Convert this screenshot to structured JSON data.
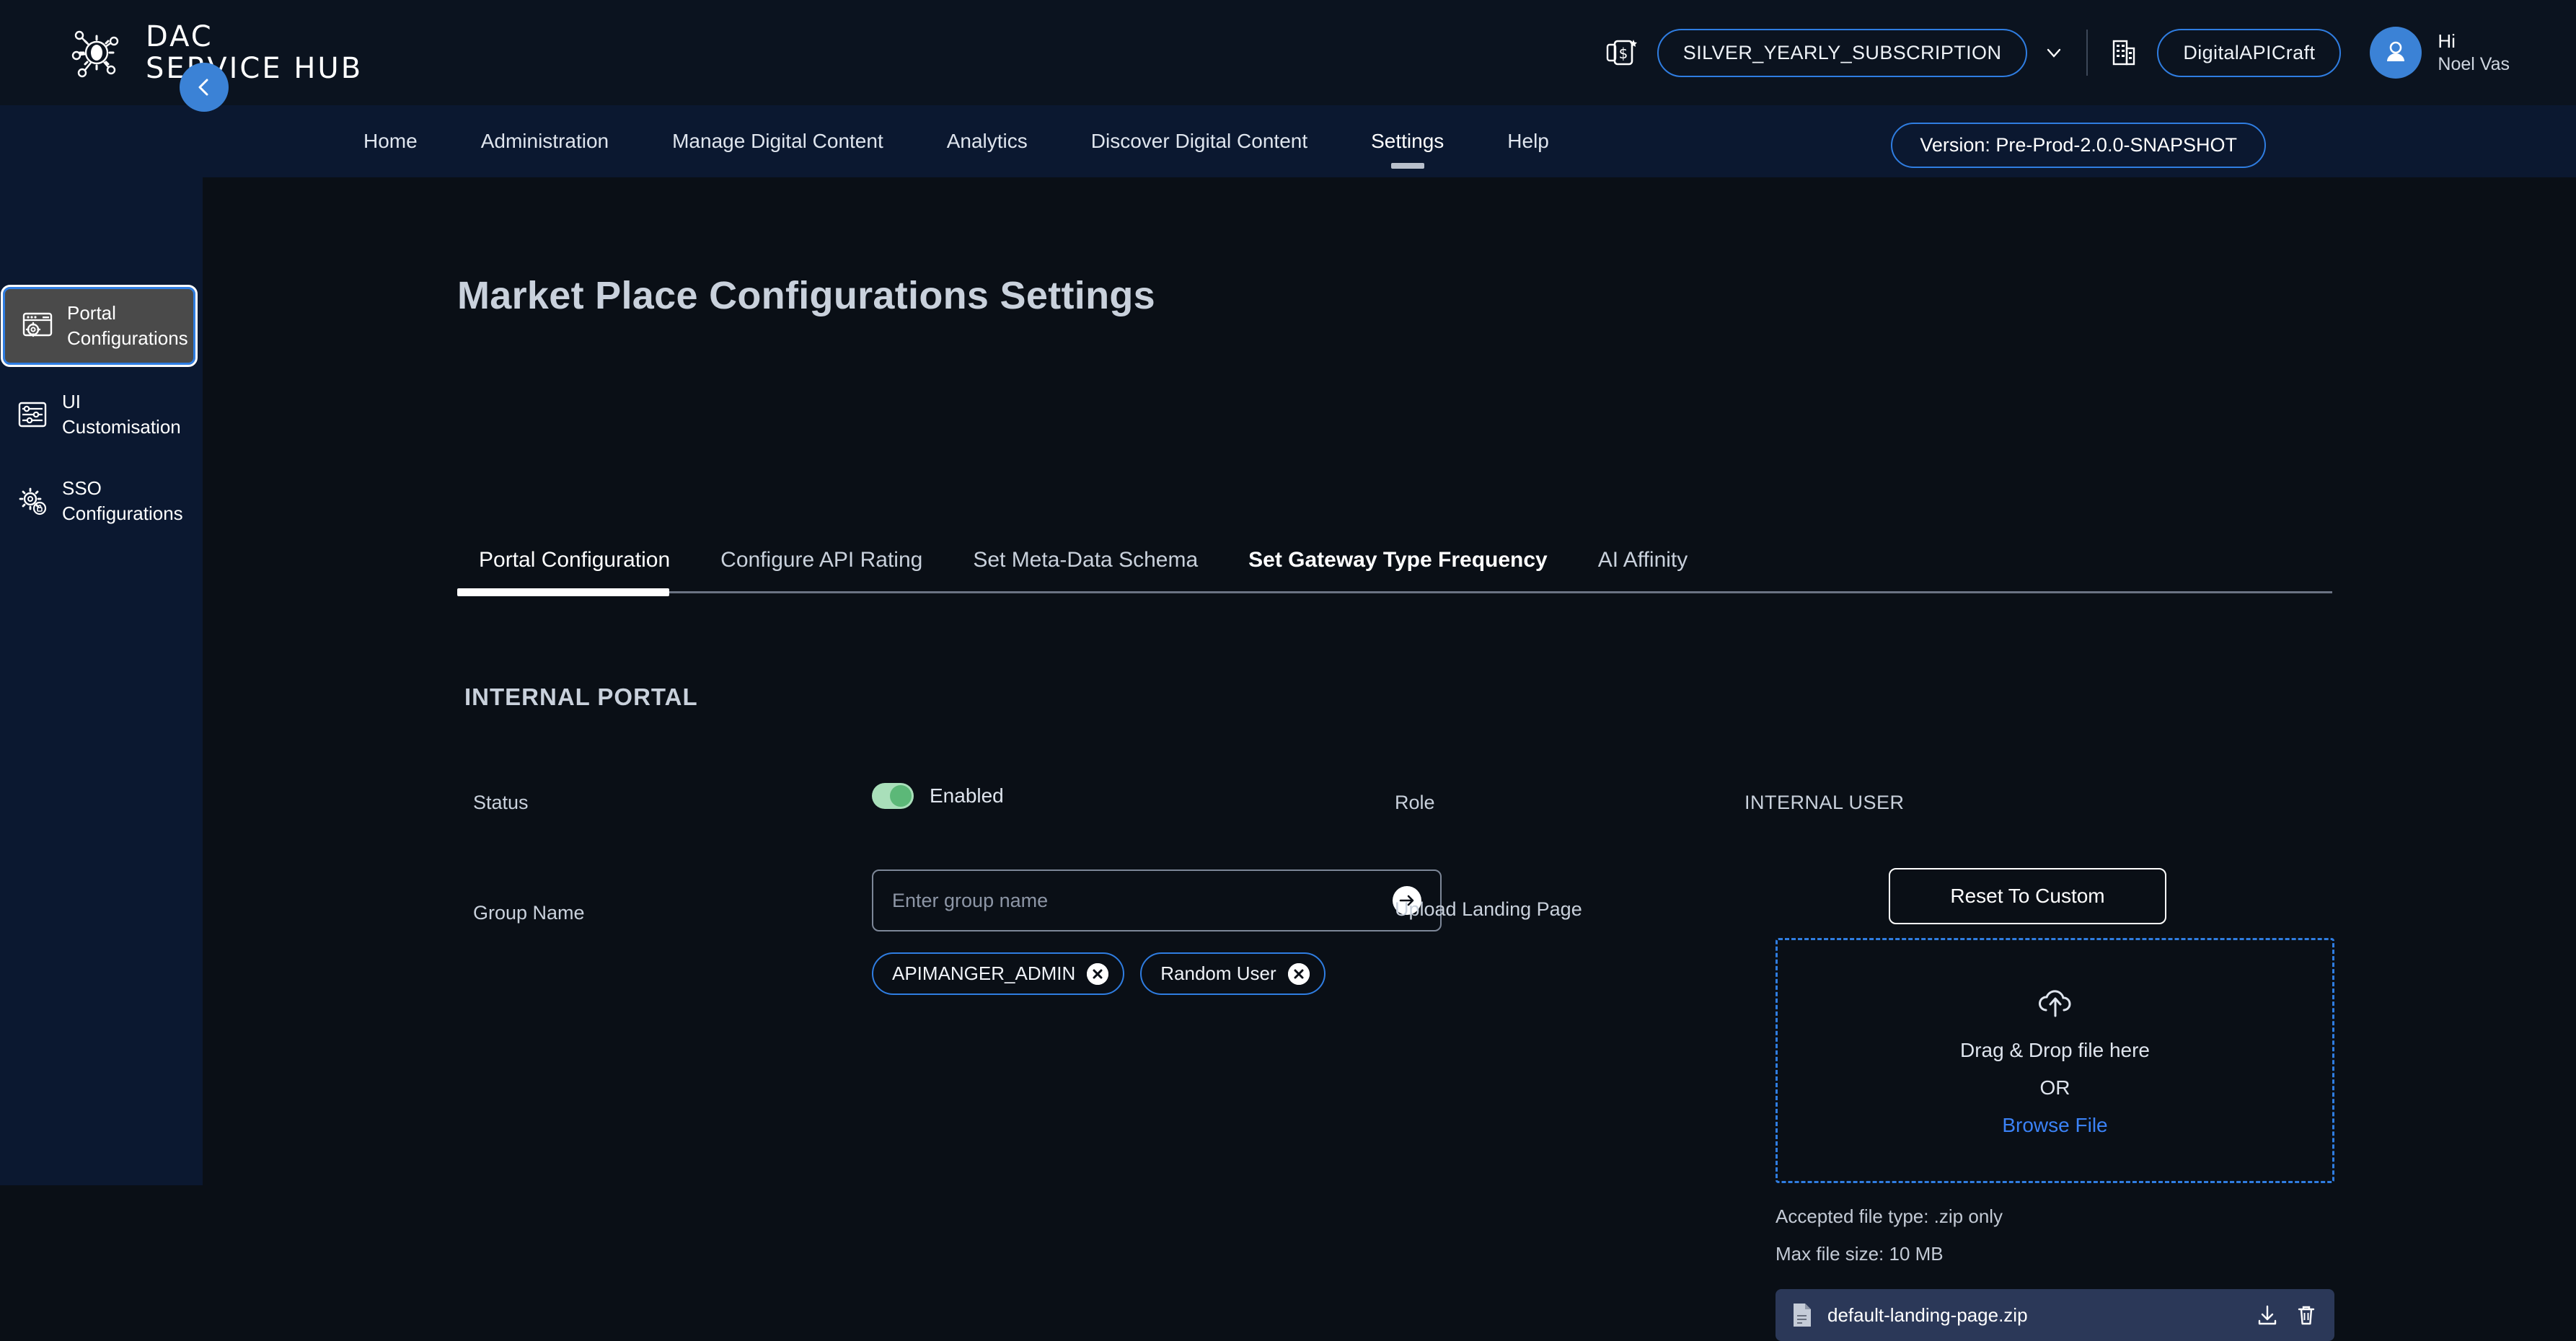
{
  "brand": {
    "line1": "DAC",
    "line2": "SERVICE HUB",
    "logo_icon": "network-gear-icon"
  },
  "header": {
    "billing_icon": "subscription-card-icon",
    "subscription": "SILVER_YEARLY_SUBSCRIPTION",
    "chevron_icon": "chevron-down-icon",
    "org_icon": "building-icon",
    "organization": "DigitalAPICraft",
    "avatar_icon": "user-avatar-icon",
    "greeting": "Hi",
    "user_name": "Noel Vas"
  },
  "nav": {
    "items": [
      {
        "label": "Home",
        "active": false
      },
      {
        "label": "Administration",
        "active": false
      },
      {
        "label": "Manage Digital Content",
        "active": false
      },
      {
        "label": "Analytics",
        "active": false
      },
      {
        "label": "Discover Digital Content",
        "active": false
      },
      {
        "label": "Settings",
        "active": true
      },
      {
        "label": "Help",
        "active": false
      }
    ],
    "version": "Version: Pre-Prod-2.0.0-SNAPSHOT"
  },
  "sidebar": {
    "collapse_icon": "chevron-left-icon",
    "items": [
      {
        "label": "Portal Configurations",
        "icon": "browser-gear-icon",
        "active": true
      },
      {
        "label": "UI Customisation",
        "icon": "sliders-icon",
        "active": false
      },
      {
        "label": "SSO Configurations",
        "icon": "gear-lock-icon",
        "active": false
      }
    ]
  },
  "main": {
    "page_title": "Market Place Configurations Settings",
    "tabs": [
      {
        "label": "Portal Configuration",
        "active": true,
        "bold": false
      },
      {
        "label": "Configure API Rating",
        "active": false,
        "bold": false
      },
      {
        "label": "Set Meta-Data Schema",
        "active": false,
        "bold": false
      },
      {
        "label": "Set Gateway Type Frequency",
        "active": false,
        "bold": true
      },
      {
        "label": "AI Affinity",
        "active": false,
        "bold": false
      }
    ],
    "section_title": "INTERNAL PORTAL",
    "fields": {
      "status_label": "Status",
      "status_value": "Enabled",
      "status_enabled": true,
      "group_name_label": "Group Name",
      "group_name_value": "",
      "group_name_placeholder": "Enter group name",
      "submit_icon": "arrow-right-icon",
      "chips": [
        {
          "label": "APIMANGER_ADMIN",
          "remove_icon": "close-icon"
        },
        {
          "label": "Random User",
          "remove_icon": "close-icon"
        }
      ],
      "role_label": "Role",
      "role_value": "INTERNAL USER",
      "upload_label": "Upload Landing Page",
      "reset_button": "Reset To Custom"
    },
    "dropzone": {
      "icon": "cloud-upload-icon",
      "main_text": "Drag & Drop file here",
      "or_text": "OR",
      "browse_text": "Browse File"
    },
    "hints": {
      "accepted": "Accepted file type: .zip only",
      "max_size": "Max file size: 10 MB"
    },
    "file": {
      "doc_icon": "document-icon",
      "name": "default-landing-page.zip",
      "download_icon": "download-icon",
      "delete_icon": "trash-icon"
    }
  },
  "colors": {
    "accent_blue": "#2f7de1",
    "link_blue": "#3b82f6",
    "toggle_green": "#a9dfba",
    "topbar_bg": "#0b131f",
    "nav_bg": "#0b1830",
    "main_bg": "#0a0f16",
    "file_row_bg": "#2b3858"
  }
}
